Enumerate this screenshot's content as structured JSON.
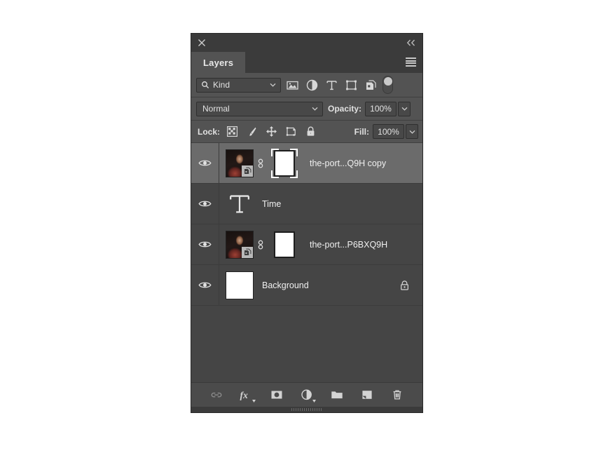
{
  "panel": {
    "title_tab": "Layers",
    "close_icon": "close-icon",
    "collapse_icon": "double-chevron-left-icon",
    "menu_icon": "panel-menu-icon"
  },
  "filter_row": {
    "kind_label": "Kind",
    "search_icon": "search-icon",
    "dropdown_icon": "chevron-down-icon",
    "type_filters": [
      {
        "name": "filter-pixel-layers",
        "icon": "image-icon"
      },
      {
        "name": "filter-adjustment-layers",
        "icon": "adjustment-circle-icon"
      },
      {
        "name": "filter-type-layers",
        "icon": "text-t-icon"
      },
      {
        "name": "filter-shape-layers",
        "icon": "shape-icon"
      },
      {
        "name": "filter-smart-objects",
        "icon": "smart-object-icon"
      }
    ],
    "toggle": {
      "name": "filter-enable-toggle",
      "state": "off"
    }
  },
  "blend_row": {
    "blend_mode": "Normal",
    "opacity_label": "Opacity:",
    "opacity_value": "100%",
    "dropdown_icon": "chevron-down-icon"
  },
  "lock_row": {
    "lock_label": "Lock:",
    "lock_buttons": [
      {
        "name": "lock-transparent-pixels",
        "icon": "checkerboard-icon"
      },
      {
        "name": "lock-image-pixels",
        "icon": "brush-icon"
      },
      {
        "name": "lock-position",
        "icon": "move-arrows-icon"
      },
      {
        "name": "lock-artboard-nesting",
        "icon": "artboard-icon"
      },
      {
        "name": "lock-all",
        "icon": "padlock-icon"
      }
    ],
    "fill_label": "Fill:",
    "fill_value": "100%"
  },
  "layers": [
    {
      "name": "the-port...Q9H copy",
      "selected": true,
      "visible": true,
      "thumb_type": "photo",
      "smart_object": true,
      "linked": true,
      "has_mask": true,
      "mask_targeted": true,
      "locked": false
    },
    {
      "name": "Time",
      "selected": false,
      "visible": true,
      "thumb_type": "type",
      "smart_object": false,
      "linked": false,
      "has_mask": false,
      "mask_targeted": false,
      "locked": false
    },
    {
      "name": "the-port...P6BXQ9H",
      "selected": false,
      "visible": true,
      "thumb_type": "photo",
      "smart_object": true,
      "linked": true,
      "has_mask": true,
      "mask_targeted": false,
      "locked": false
    },
    {
      "name": "Background",
      "selected": false,
      "visible": true,
      "thumb_type": "white",
      "smart_object": false,
      "linked": false,
      "has_mask": false,
      "mask_targeted": false,
      "locked": true
    }
  ],
  "bottom_toolbar": [
    {
      "name": "link-layers-button",
      "icon": "link-icon",
      "enabled": false
    },
    {
      "name": "layer-style-button",
      "icon": "fx-icon",
      "enabled": true
    },
    {
      "name": "add-layer-mask-button",
      "icon": "mask-icon",
      "enabled": true
    },
    {
      "name": "new-adjustment-layer-button",
      "icon": "adjustment-circle-icon",
      "enabled": true
    },
    {
      "name": "new-group-button",
      "icon": "folder-icon",
      "enabled": true
    },
    {
      "name": "new-layer-button",
      "icon": "new-layer-icon",
      "enabled": true
    },
    {
      "name": "delete-layer-button",
      "icon": "trash-icon",
      "enabled": true
    }
  ],
  "colors": {
    "panel_bg": "#434343",
    "row_bg": "#535353",
    "list_bg": "#454545",
    "selected_row": "#6b6b6b",
    "text": "#f0f0f0",
    "icon": "#d8d8d8"
  }
}
